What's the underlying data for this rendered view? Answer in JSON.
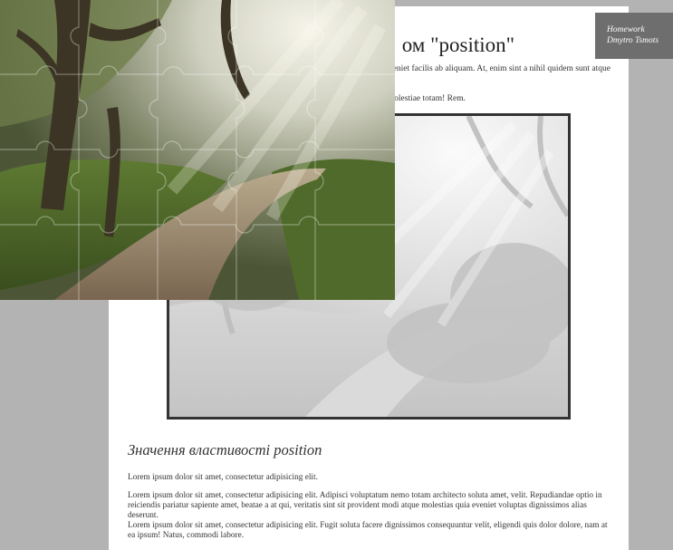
{
  "page": {
    "title": "ом \"position\"",
    "intro_line_1": "eveniet facilis ab aliquam. At, enim sint a nihil quidem sunt atque",
    "intro_line_2": "molestiae totam! Rem."
  },
  "section": {
    "title": "Значення властивості position",
    "paragraphs": [
      "Lorem ipsum dolor sit amet, consectetur adipisicing elit.",
      "Lorem ipsum dolor sit amet, consectetur adipisicing elit. Adipisci voluptatum nemo totam architecto soluta amet, velit. Repudiandae optio in reiciendis pariatur sapiente amet, beatae a at qui, veritatis sint sit provident modi atque molestias quia eveniet voluptas dignissimos alias deserunt.",
      "Lorem ipsum dolor sit amet, consectetur adipisicing elit. Fugit soluta facere dignissimos consequuntur velit, eligendi quis dolor dolore, nam at ea ipsum! Natus, commodi labore."
    ]
  },
  "badge": {
    "line1": "Homework",
    "line2": "Dmytro Tsmots"
  },
  "colors": {
    "background": "#b3b3b3",
    "page": "#ffffff",
    "badge": "#6e6e6e",
    "frame_border": "#333333"
  }
}
